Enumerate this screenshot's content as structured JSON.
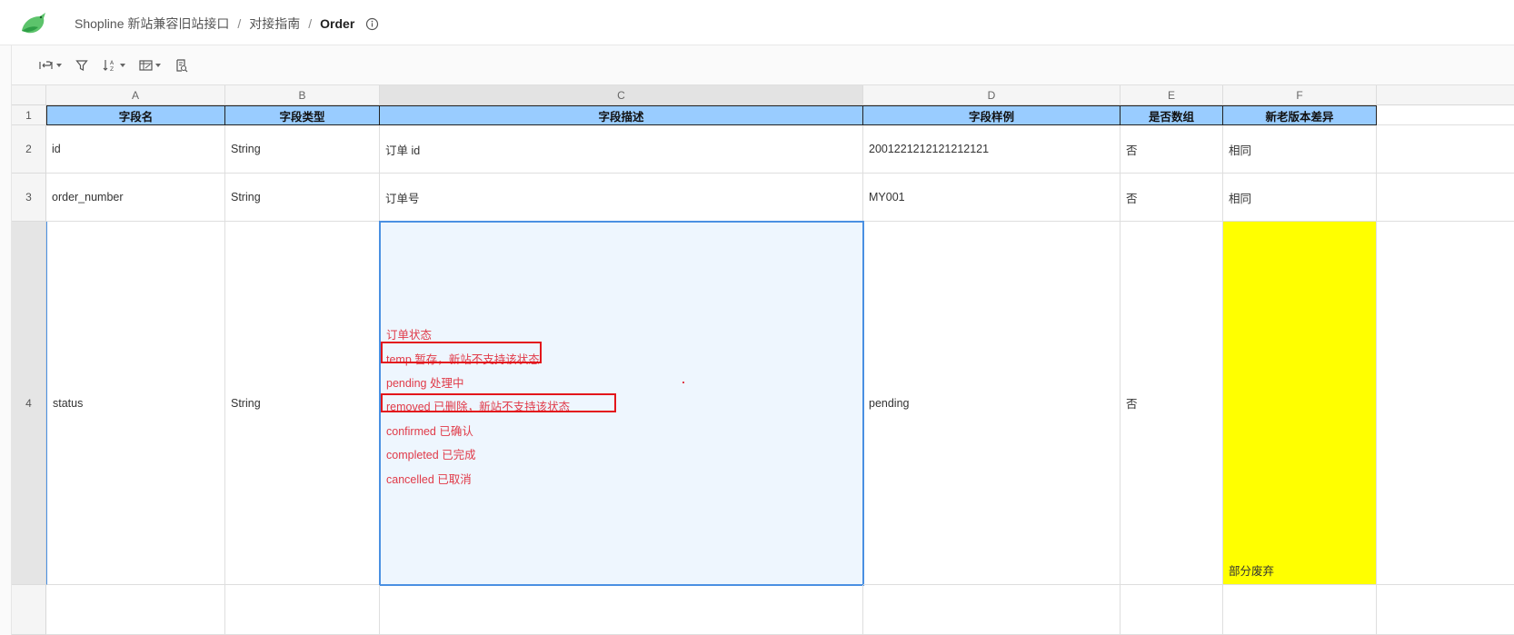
{
  "breadcrumb": {
    "items": [
      "Shopline 新站兼容旧站接口",
      "对接指南"
    ],
    "current": "Order",
    "separator": "/"
  },
  "toolbar": {
    "buttons": [
      "wrap-icon",
      "filter-icon",
      "sort-icon",
      "table-format-icon",
      "find-icon"
    ]
  },
  "sheet": {
    "columns": [
      "A",
      "B",
      "C",
      "D",
      "E",
      "F"
    ],
    "rows": [
      "1",
      "2",
      "3",
      "4"
    ],
    "header": [
      "字段名",
      "字段类型",
      "字段描述",
      "字段样例",
      "是否数组",
      "新老版本差异"
    ],
    "row2": [
      "id",
      "String",
      "订单 id",
      "2001221212121212121",
      "否",
      "相同"
    ],
    "row3": [
      "order_number",
      "String",
      "订单号",
      "MY001",
      "否",
      "相同"
    ],
    "row4": {
      "name": "status",
      "type": "String",
      "desc_lines": [
        "订单状态",
        "temp 暂存，新站不支持该状态",
        "pending 处理中",
        "removed 已删除，新站不支持该状态",
        "confirmed 已确认",
        "completed 已完成",
        "cancelled 已取消"
      ],
      "sample": "pending",
      "is_array": "否",
      "diff": "部分废弃"
    }
  },
  "colors": {
    "header_fill": "#99ccff",
    "highlight_fill": "#ffff00",
    "selection_border": "#4a90e2",
    "red_text": "#e03a48",
    "red_box": "#e3161b"
  }
}
